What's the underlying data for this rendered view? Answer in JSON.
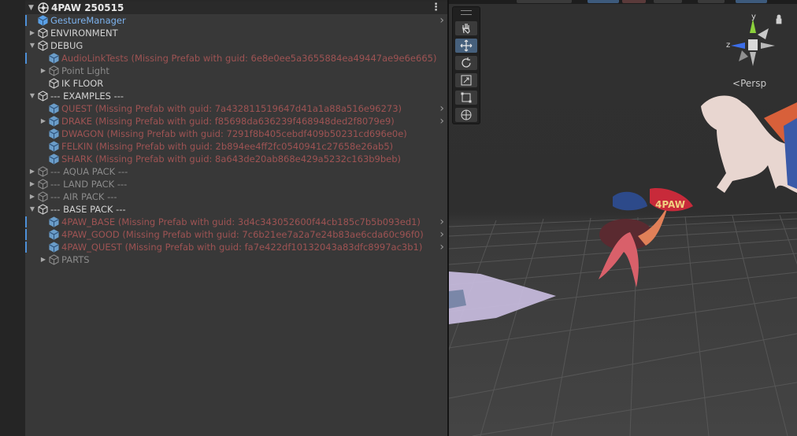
{
  "hierarchy": {
    "scene_name": "4PAW 250515",
    "rows": [
      {
        "label": "GestureManager",
        "indent": 0,
        "fold": "",
        "kind": "prefab",
        "chevron": true,
        "bar": true
      },
      {
        "label": "ENVIRONMENT",
        "indent": 0,
        "fold": "right",
        "kind": "normal",
        "chevron": false,
        "bar": false
      },
      {
        "label": "DEBUG",
        "indent": 0,
        "fold": "down",
        "kind": "normal",
        "chevron": false,
        "bar": false
      },
      {
        "label": "AudioLinkTests (Missing Prefab with guid: 6e8e0ee5a3655884ea49447ae9e6e665)",
        "indent": 1,
        "fold": "",
        "kind": "missing",
        "chevron": false,
        "bar": true
      },
      {
        "label": "Point Light",
        "indent": 1,
        "fold": "right",
        "kind": "dim",
        "chevron": false,
        "bar": false
      },
      {
        "label": "IK FLOOR",
        "indent": 1,
        "fold": "",
        "kind": "normal",
        "chevron": false,
        "bar": false
      },
      {
        "label": "--- EXAMPLES ---",
        "indent": 0,
        "fold": "down",
        "kind": "normal",
        "chevron": false,
        "bar": false
      },
      {
        "label": "QUEST (Missing Prefab with guid: 7a432811519647d41a1a88a516e96273)",
        "indent": 1,
        "fold": "",
        "kind": "missing",
        "chevron": true,
        "bar": false
      },
      {
        "label": "DRAKE (Missing Prefab with guid: f85698da636239f468948ded2f8079e9)",
        "indent": 1,
        "fold": "right",
        "kind": "missing",
        "chevron": true,
        "bar": false
      },
      {
        "label": "DWAGON (Missing Prefab with guid: 7291f8b405cebdf409b50231cd696e0e)",
        "indent": 1,
        "fold": "",
        "kind": "missing",
        "chevron": false,
        "bar": false
      },
      {
        "label": "FELKIN (Missing Prefab with guid: 2b894ee4ff2fc0540941c27658e26ab5)",
        "indent": 1,
        "fold": "",
        "kind": "missing",
        "chevron": false,
        "bar": false
      },
      {
        "label": "SHARK (Missing Prefab with guid: 8a643de20ab868e429a5232c163b9beb)",
        "indent": 1,
        "fold": "",
        "kind": "missing",
        "chevron": false,
        "bar": false
      },
      {
        "label": "--- AQUA PACK ---",
        "indent": 0,
        "fold": "right",
        "kind": "dim",
        "chevron": false,
        "bar": false
      },
      {
        "label": "--- LAND PACK ---",
        "indent": 0,
        "fold": "right",
        "kind": "dim",
        "chevron": false,
        "bar": false
      },
      {
        "label": "--- AIR PACK ---",
        "indent": 0,
        "fold": "right",
        "kind": "dim",
        "chevron": false,
        "bar": false
      },
      {
        "label": "--- BASE PACK ---",
        "indent": 0,
        "fold": "down",
        "kind": "normal",
        "chevron": false,
        "bar": false
      },
      {
        "label": "4PAW_BASE (Missing Prefab with guid: 3d4c343052600f44cb185c7b5b093ed1)",
        "indent": 1,
        "fold": "",
        "kind": "missing",
        "chevron": true,
        "bar": true
      },
      {
        "label": "4PAW_GOOD (Missing Prefab with guid: 7c6b21ee7a2a7e24b83ae6cda60c96f0)",
        "indent": 1,
        "fold": "",
        "kind": "missing",
        "chevron": true,
        "bar": true
      },
      {
        "label": "4PAW_QUEST (Missing Prefab with guid: fa7e422df10132043a83dfc8997ac3b1)",
        "indent": 1,
        "fold": "",
        "kind": "missing",
        "chevron": true,
        "bar": true
      },
      {
        "label": "PARTS",
        "indent": 1,
        "fold": "right",
        "kind": "dim",
        "chevron": false,
        "bar": false
      }
    ]
  },
  "scene_view": {
    "camera_mode": "Persp",
    "gizmo_axes": {
      "y": "y",
      "z": "z"
    },
    "tools": [
      "hand-tool",
      "move-tool",
      "rotate-tool",
      "scale-tool",
      "rect-tool",
      "transform-tool"
    ],
    "active_tool": "move-tool"
  },
  "colors": {
    "missing_prefab": "#9e5353",
    "prefab": "#7cb2ee",
    "selection_bar": "#4d90d8"
  }
}
